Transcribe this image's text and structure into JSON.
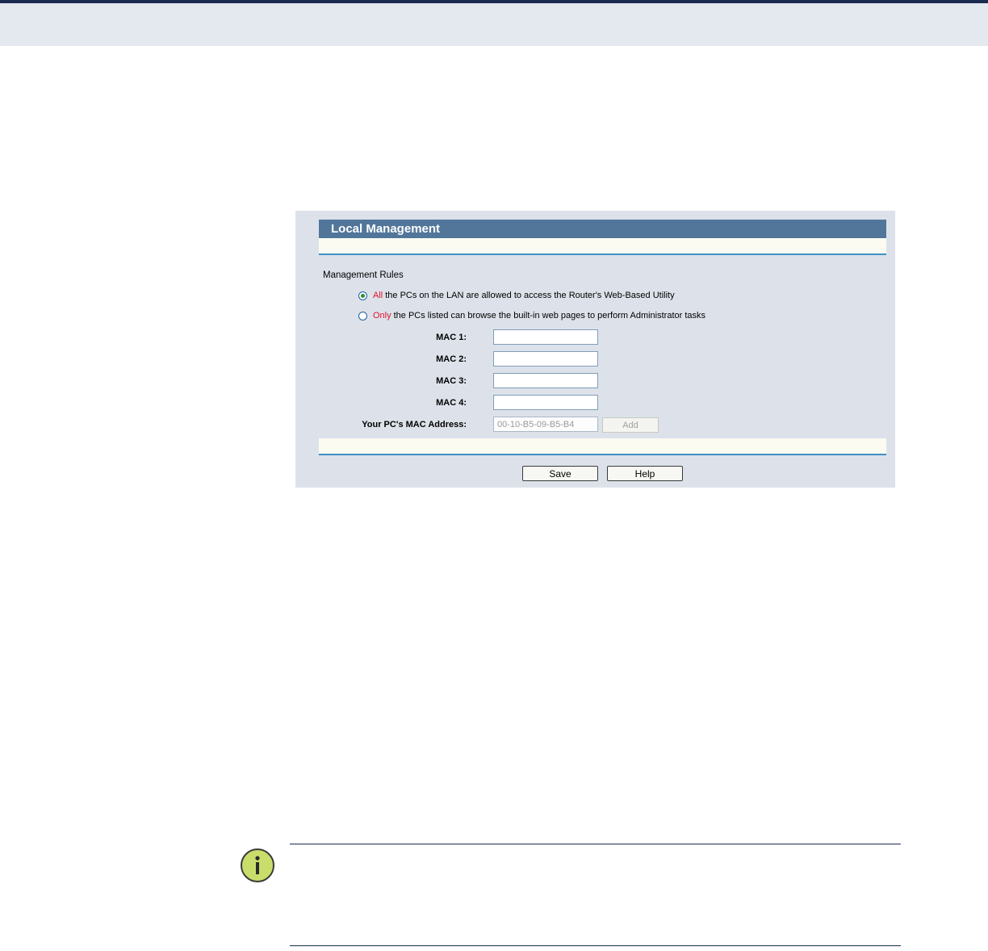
{
  "panel": {
    "title": "Local Management",
    "section_title": "Management Rules",
    "option_all": {
      "keyword": "All",
      "text": "the PCs on the LAN are allowed to access the Router's Web-Based Utility",
      "selected": true
    },
    "option_only": {
      "keyword": "Only",
      "text": "the PCs listed can browse the built-in web pages to perform Administrator tasks",
      "selected": false
    },
    "mac_fields": [
      {
        "label": "MAC 1:",
        "value": ""
      },
      {
        "label": "MAC 2:",
        "value": ""
      },
      {
        "label": "MAC 3:",
        "value": ""
      },
      {
        "label": "MAC 4:",
        "value": ""
      }
    ],
    "your_mac": {
      "label": "Your PC's MAC Address:",
      "value": "00-10-B5-09-B5-B4"
    },
    "add_label": "Add",
    "save_label": "Save",
    "help_label": "Help"
  },
  "colors": {
    "header": "#51769a",
    "accent_line": "#3e8fc5",
    "keyword_red": "#e0102a",
    "screenshot_bg": "#dde2ea",
    "icon_fill": "#c9de6a"
  },
  "icons": {
    "note": "info-icon"
  }
}
